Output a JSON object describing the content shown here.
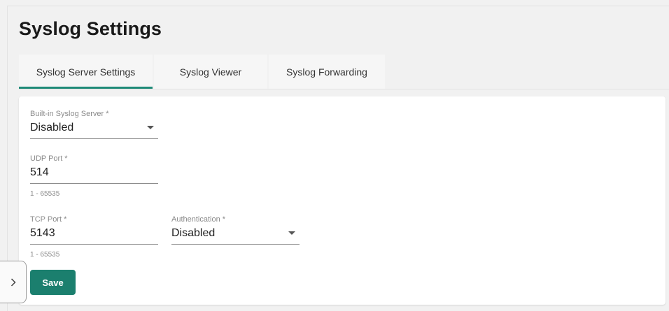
{
  "page": {
    "title": "Syslog Settings"
  },
  "tabs": [
    {
      "label": "Syslog Server Settings",
      "active": true
    },
    {
      "label": "Syslog Viewer",
      "active": false
    },
    {
      "label": "Syslog Forwarding",
      "active": false
    }
  ],
  "form": {
    "builtin_server": {
      "label": "Built-in Syslog Server *",
      "value": "Disabled"
    },
    "udp_port": {
      "label": "UDP Port *",
      "value": "514",
      "hint": "1 - 65535"
    },
    "tcp_port": {
      "label": "TCP Port *",
      "value": "5143",
      "hint": "1 - 65535"
    },
    "authentication": {
      "label": "Authentication *",
      "value": "Disabled"
    }
  },
  "actions": {
    "save_label": "Save"
  },
  "icons": {
    "dropdown": "chevron-down-icon",
    "sidebar_toggle": "chevron-right-icon"
  },
  "colors": {
    "accent": "#1f8a78",
    "button": "#1b7f6e"
  }
}
